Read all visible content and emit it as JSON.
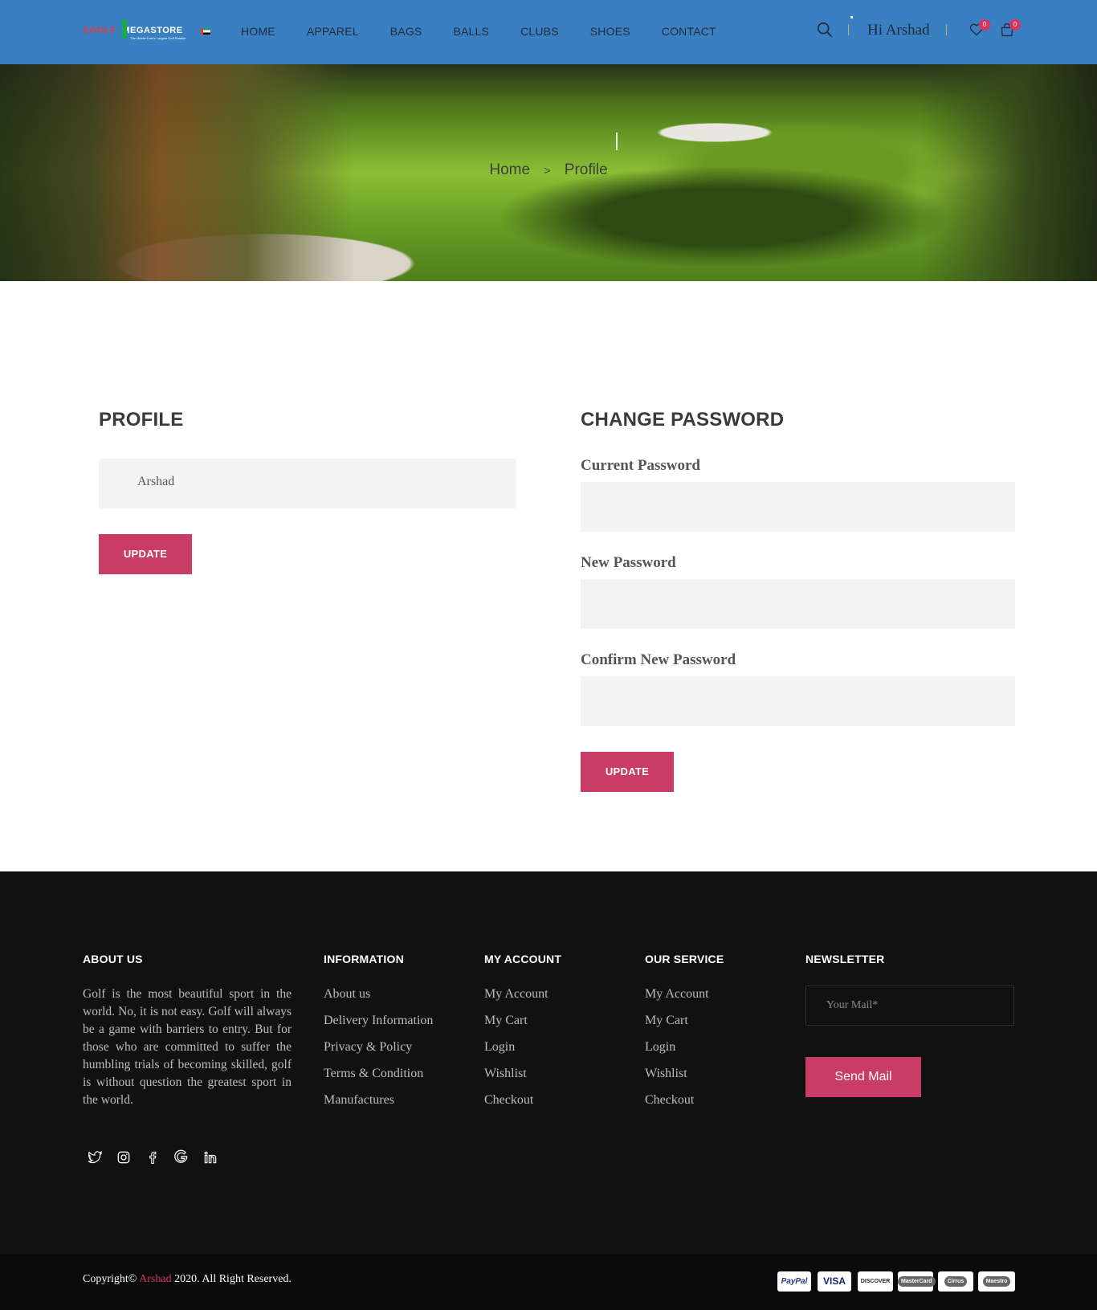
{
  "header": {
    "logo": {
      "brand_left": "EGOLF",
      "brand_right": "MEGASTORE",
      "tagline": "The Middle East's Largest Golf Retailer"
    },
    "nav": [
      "HOME",
      "APPAREL",
      "BAGS",
      "BALLS",
      "CLUBS",
      "SHOES",
      "CONTACT"
    ],
    "greeting": "Hi Arshad",
    "wishlist_count": "0",
    "cart_count": "0",
    "icons": [
      "search-icon",
      "heart-icon",
      "shopping-bag-icon"
    ]
  },
  "hero": {
    "breadcrumb": {
      "home": "Home",
      "separator": ">",
      "current": "Profile"
    }
  },
  "profile": {
    "title": "PROFILE",
    "name_value": "Arshad",
    "update_label": "UPDATE"
  },
  "change_password": {
    "title": "CHANGE PASSWORD",
    "current_label": "Current Password",
    "new_label": "New Password",
    "confirm_label": "Confirm New Password",
    "update_label": "UPDATE"
  },
  "footer": {
    "about": {
      "title": "ABOUT US",
      "text": "Golf is the most beautiful sport in the world. No, it is not easy. Golf will always be a game with barriers to entry. But for those who are committed to suffer the humbling trials of becoming skilled, golf is without question the greatest sport in the world.",
      "social": [
        "twitter-icon",
        "instagram-icon",
        "facebook-icon",
        "google-icon",
        "linkedin-icon"
      ]
    },
    "information": {
      "title": "INFORMATION",
      "items": [
        "About us",
        "Delivery Information",
        "Privacy & Policy",
        "Terms & Condition",
        "Manufactures"
      ]
    },
    "my_account": {
      "title": "MY ACCOUNT",
      "items": [
        "My Account",
        "My Cart",
        "Login",
        "Wishlist",
        "Checkout"
      ]
    },
    "our_service": {
      "title": "OUR SERVICE",
      "items": [
        "My Account",
        "My Cart",
        "Login",
        "Wishlist",
        "Checkout"
      ]
    },
    "newsletter": {
      "title": "NEWSLETTER",
      "placeholder": "Your Mail*",
      "button_label": "Send Mail"
    }
  },
  "bottom": {
    "copyright_prefix": "Copyright©",
    "copyright_name": "Arshad",
    "copyright_suffix": "2020. All Right Reserved.",
    "payments": [
      "PayPal",
      "VISA",
      "DISCOVER",
      "MasterCard",
      "Cirrus",
      "Maestro"
    ]
  },
  "colors": {
    "header_bg": "#3a7fc1",
    "accent": "#c93c66",
    "footer_bg": "#111111"
  }
}
